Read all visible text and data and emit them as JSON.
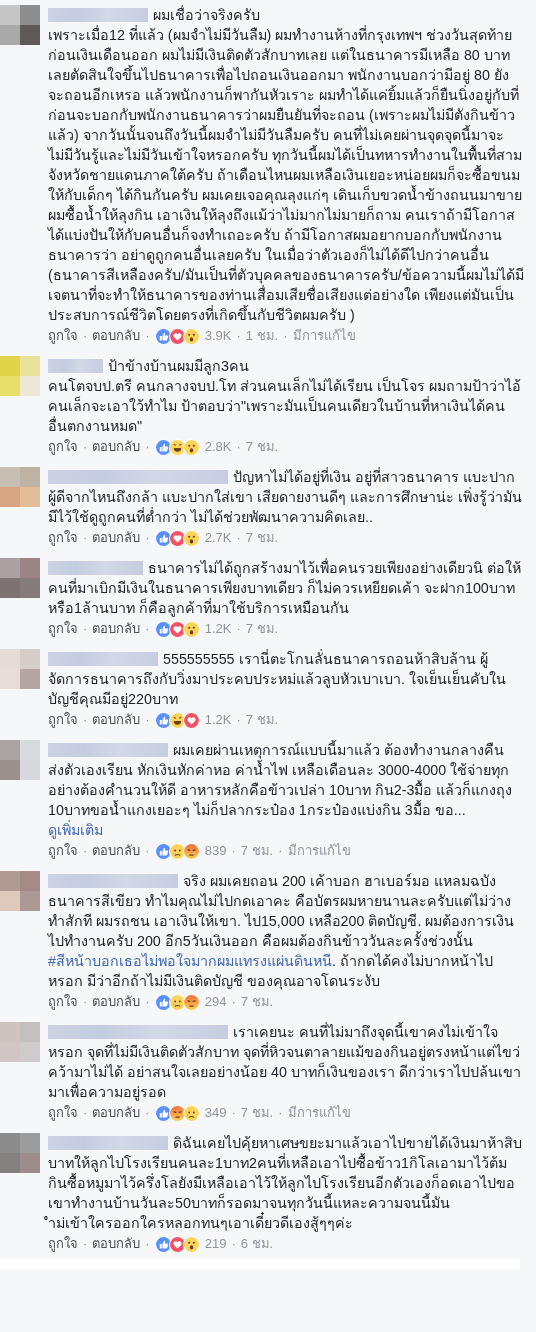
{
  "separator": "·",
  "comments": [
    {
      "body": [
        {
          "kind": "text",
          "text": "ผมเชื่อว่าจริงครับ\nเพราะเมื่อ12 ที่แล้ว (ผมจำไม่มีวันลืม) ผมทำงานห้างที่กรุงเทพฯ ช่วงวันสุดท้ายก่อนเงินเดือนออก ผมไม่มีเงินติดตัวสักบาทเลย แต่ในธนาคารมีเหลือ 80 บาทเลยตัดสินใจขึ้นไปธนาคารเพื่อไปถอนเงินออกมา พนักงานบอกว่ามีอยู่ 80 ยังจะถอนอีกเหรอ แล้วพนักงานก็พากันหัวเราะ ผมทำได้แค่ยิ้มแล้วก็ยืนนิ่งอยู่กับที่ ก่อนจะบอกกับพนักงานธนาคารว่าผมยืนยันที่จะถอน (เพราะผมไม่มีตังกินข้าวแล้ว) จากวันนั้นจนถึงวันนี้ผมจำไม่มีวันลืมครับ คนที่ไม่เคยผ่านจุดจุดนี้มาจะไม่มีวันรู้และไม่มีวันเข้าใจหรอกครับ ทุกวันนี้ผมได้เป็นทหารทำงานในพื้นที่สามจังหวัดชายแดนภาคใต้ครับ ถ้าเดือนไหนผมเหลือเงินเยอะหน่อยผมก็จะซื้อขนมให้กับเด็กๆ ได้กินกันครับ ผมเคยเจอคุณลุงแก่ๆ เดินเก็บขวดน้ำข้างถนนมาขาย ผมซื้อน้ำให้ลุงกิน เอาเงินให้ลุงถึงแม้ว่าไม่มากไม่มายก็ถาม คนเราถ้ามีโอกาสได้แบ่งปันให้กับคนอื่นก็จงทำเถอะครับ ถ้ามีโอกาสผมอยากบอกกับพนักงานธนาคารว่า อย่าดูถูกคนอื่นเลยครับ ในเมื่อว่าตัวเองก็ไม่ได้ดีไปกว่าคนอื่น (ธนาคารสีเหลืองครับ/มันเป็นที่ตัวบุคคลของธนาคารครับ/ข้อความนี้ผมไม่ได้มีเจตนาที่จะทำให้ธนาคารของท่านเสื่อมเสียชื่อเสียงแต่อย่างใด เพียงแต่มันเป็นประสบการณ์ชีวิตโดยตรงที่เกิดขึ้นกับชีวิตผมครับ )"
        }
      ],
      "like": "ถูกใจ",
      "reply": "ตอบกลับ",
      "reactions": [
        {
          "kind": "like"
        },
        {
          "kind": "love"
        },
        {
          "kind": "wow"
        }
      ],
      "count": "3.9K",
      "time": "1 ชม.",
      "edited": "มีการแก้ไข"
    },
    {
      "body": [
        {
          "kind": "text",
          "text": "ป้าข้างบ้านผมมีลูก3คน\nคนโตจบป.ตรี คนกลางจบป.โท ส่วนคนเล็กไม่ได้เรียน เป็นโจร ผมถามป้าว่าไอ้คนเล็กจะเอาใว้ทำไม ป้าตอบว่า\"เพราะมันเป็นคนเดียวในบ้านที่หาเงินได้คนอื่นตกงานหมด\""
        }
      ],
      "like": "ถูกใจ",
      "reply": "ตอบกลับ",
      "reactions": [
        {
          "kind": "like"
        },
        {
          "kind": "haha"
        },
        {
          "kind": "wow"
        }
      ],
      "count": "2.8K",
      "time": "7 ชม."
    },
    {
      "body": [
        {
          "kind": "text",
          "text": "ปัญหาไม่ได้อยู่ที่เงิน อยู่ที่สาวธนาคาร แบะปาก\nผู้ดีจากไหนถึงกล้า แบะปากใส่เขา เสียดายงานดีๆ และการศึกษาน่ะ เพิ่งรู้ว่ามันมีไว้ใช้ดูถูกคนที่ต่ำกว่า ไม่ได้ช่วยพัฒนาความคิดเลย.."
        }
      ],
      "like": "ถูกใจ",
      "reply": "ตอบกลับ",
      "reactions": [
        {
          "kind": "like"
        },
        {
          "kind": "love"
        },
        {
          "kind": "wow"
        }
      ],
      "count": "2.7K",
      "time": "7 ชม."
    },
    {
      "body": [
        {
          "kind": "text",
          "text": "ธนาคารไม่ได้ถูกสร้างมาไว้เพื่อคนรวยเพียงอย่างเดียวนิ ต่อให้คนที่มาเบิกมีเงินในธนาคารเพียงบาทเดียว ก็ไม่ควรเหยียดเค้า จะฝาก100บาท หรือ1ล้านบาท ก็คือลูกค้าที่มาใช้บริการเหมือนกัน"
        }
      ],
      "like": "ถูกใจ",
      "reply": "ตอบกลับ",
      "reactions": [
        {
          "kind": "like"
        },
        {
          "kind": "love"
        },
        {
          "kind": "wow"
        }
      ],
      "count": "1.2K",
      "time": "7 ชม."
    },
    {
      "body": [
        {
          "kind": "text",
          "text": "555555555 เรานี่ตะโกนลั่นธนาคารถอนห้าสิบล้าน ผู้จัดการธนาคารถึงกับวิ่งมาประคบประหม่แล้วลูบหัวเบาเบา. ใจเย็นเย็นคับในบัญชีคุณมีอยู่220บาท"
        }
      ],
      "like": "ถูกใจ",
      "reply": "ตอบกลับ",
      "reactions": [
        {
          "kind": "like"
        },
        {
          "kind": "haha"
        },
        {
          "kind": "love"
        }
      ],
      "count": "1.2K",
      "time": "7 ชม."
    },
    {
      "body": [
        {
          "kind": "text",
          "text": "ผมเคยผ่านเหตุการณ์แบบนี้มาแล้ว ต้องทำงานกลางคืน ส่งตัวเองเรียน หักเงินหักค่าหอ ค่าน้ำไฟ เหลือเดือนละ 3000-4000 ใช้จ่ายทุกอย่างต้องคำนวนให้ดี อาหารหลักคือข้าวเปล่า 10บาท กิน2-3มื้อ แล้วก็แกงถุง 10บาทขอน้ำแกงเยอะๆ ไม่ก็ปลากระป๋อง 1กระป๋องแบ่งกิน 3มื้อ ขอ... "
        },
        {
          "kind": "more",
          "text": "ดูเพิ่มเติม"
        }
      ],
      "like": "ถูกใจ",
      "reply": "ตอบกลับ",
      "reactions": [
        {
          "kind": "like"
        },
        {
          "kind": "sad"
        },
        {
          "kind": "angry"
        }
      ],
      "count": "839",
      "time": "7 ชม.",
      "edited": "มีการแก้ไข"
    },
    {
      "body": [
        {
          "kind": "text",
          "text": "จริง ผมเคยถอน 200 เค้าบอก ฮาเบอร์มอ แหลมฉบัง ธนาคารสีเขียว ทำไมคุณไม่ไปกดเอาคะ คือบัตรผมหายนานละครับแต่ไม่ว่างทำสักที ผมรถชน เอาเงินให้เขา. ไป15,000 เหลือ200 ติดบัญชี. ผมต้องการเงินไปทำงานครับ 200 อีก5วันเงินออก คือผมต้องกินข้าววันละครั้งช่วงนั้น "
        },
        {
          "kind": "hashtag",
          "text": "#สีหน้าบอกเธอไม่พอใจมากผมแทรงแผ่นดินหนี"
        },
        {
          "kind": "text",
          "text": ". ถ้ากดได้คงไม่บากหน้าไปหรอก มีว่าอีกถ้าไม่มีเงินติดบัญชี ของคุณอาจโดนระงับ"
        }
      ],
      "like": "ถูกใจ",
      "reply": "ตอบกลับ",
      "reactions": [
        {
          "kind": "like"
        },
        {
          "kind": "sad"
        },
        {
          "kind": "angry"
        }
      ],
      "count": "294",
      "time": "7 ชม."
    },
    {
      "body": [
        {
          "kind": "text",
          "text": "เราเคยนะ คนที่ไม่มาถึงจุดนี้เขาคงไม่เข้าใจหรอก จุดที่ไม่มีเงินติดตัวสักบาท จุดที่หิวจนตาลายแม้ของกินอยู่ตรงหน้าแต่ไขว่คว้ามาไม่ได้ อย่าสนใจเลยอย่างน้อย 40 บาทก็เงินของเรา ดีกว่าเราไปปล้นเขามาเพื่อความอยู่รอด"
        }
      ],
      "like": "ถูกใจ",
      "reply": "ตอบกลับ",
      "reactions": [
        {
          "kind": "like"
        },
        {
          "kind": "angry"
        },
        {
          "kind": "sad"
        }
      ],
      "count": "349",
      "time": "7 ชม.",
      "edited": "มีการแก้ไข"
    },
    {
      "body": [
        {
          "kind": "text",
          "text": "ดิฉันเคยไปคุ้ยหาเศษขยะมาแล้วเอาไปขายได้เงินมาห้าสิบบาทให้ลูกไปโรงเรียนคนละ1บาท2คนที่เหลือเอาไปซื้อข้าว1กิโลเอามาไว้ต้มกินซื้อหมูมาไว้ครึ่งโลยังมีเหลือเอาไว้ให้ลูกไปโรงเรียนอีกตัวเองก็อดเอาไปขอเขาทำงานบ้านวันละ50บาทก็รอดมาจนทุกวันนี้แหละความจนนี้มัน\nำม่เข้าใครออกใครหลอกทนๆเอาเดี๋ยวดีเองสู้ๆๆค่ะ"
        }
      ],
      "like": "ถูกใจ",
      "reply": "ตอบกลับ",
      "reactions": [
        {
          "kind": "like"
        },
        {
          "kind": "love"
        },
        {
          "kind": "wow"
        }
      ],
      "count": "219",
      "time": "6 ชม."
    }
  ]
}
